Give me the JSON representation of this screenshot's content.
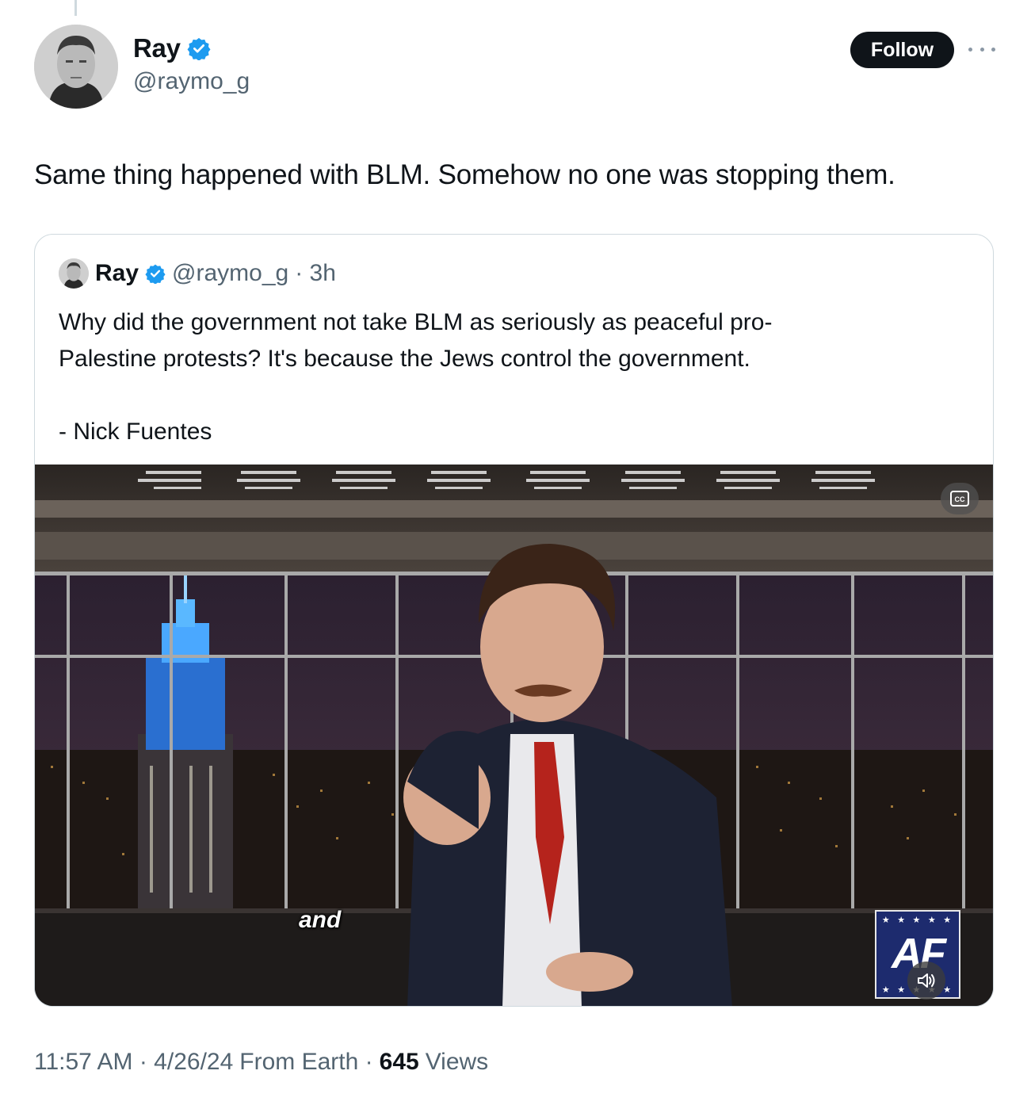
{
  "tweet": {
    "author": {
      "name": "Ray",
      "handle": "@raymo_g",
      "verified": true
    },
    "follow_label": "Follow",
    "more_icon": "more-horizontal-icon",
    "text": "Same thing happened with BLM. Somehow no one was stopping them.",
    "timestamp": "11:57 AM · 4/26/24",
    "source": "From Earth ·",
    "views_count": "645",
    "views_label": "Views"
  },
  "quote": {
    "author": {
      "name": "Ray",
      "handle": "@raymo_g",
      "verified": true
    },
    "time": "· 3h",
    "text_line1": "Why did the government not take BLM as seriously as peaceful pro-",
    "text_line2": "Palestine protests? It's because the Jews control the government.",
    "text_line3": "- Nick Fuentes",
    "video": {
      "caption_word": "and",
      "logo_text": "AF",
      "logo_stars": "★ ★ ★ ★ ★",
      "controls": [
        "closed-captions-icon",
        "volume-icon"
      ]
    }
  },
  "colors": {
    "verified_badge": "#1d9bf0",
    "follow_button": "#0f1419",
    "secondary_text": "#536471",
    "border": "#cfd9de"
  }
}
